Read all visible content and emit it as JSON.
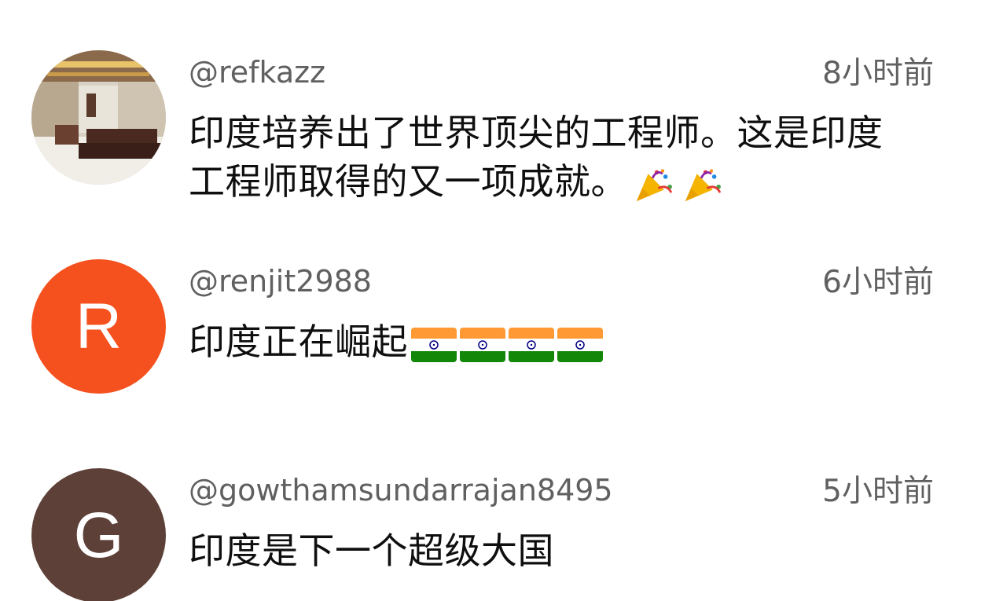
{
  "comments": [
    {
      "handle": "@refkazz",
      "time": "8小时前",
      "avatar": {
        "type": "photo",
        "icon": "room-photo-avatar"
      },
      "text_lines": [
        "印度培养出了世界顶尖的工程师。这是印度",
        "工程师取得的又一项成就。"
      ],
      "emojis": [
        "party-popper-icon",
        "party-popper-icon"
      ]
    },
    {
      "handle": "@renjit2988",
      "time": "6小时前",
      "avatar": {
        "type": "letter",
        "letter": "R",
        "color": "#f5511e"
      },
      "text_lines": [
        "印度正在崛起"
      ],
      "emojis": [
        "india-flag-icon",
        "india-flag-icon",
        "india-flag-icon",
        "india-flag-icon"
      ]
    },
    {
      "handle": "@gowthamsundarrajan8495",
      "time": "5小时前",
      "avatar": {
        "type": "letter",
        "letter": "G",
        "color": "#5d4037"
      },
      "text_lines": [
        "印度是下一个超级大国"
      ],
      "emojis": []
    }
  ]
}
